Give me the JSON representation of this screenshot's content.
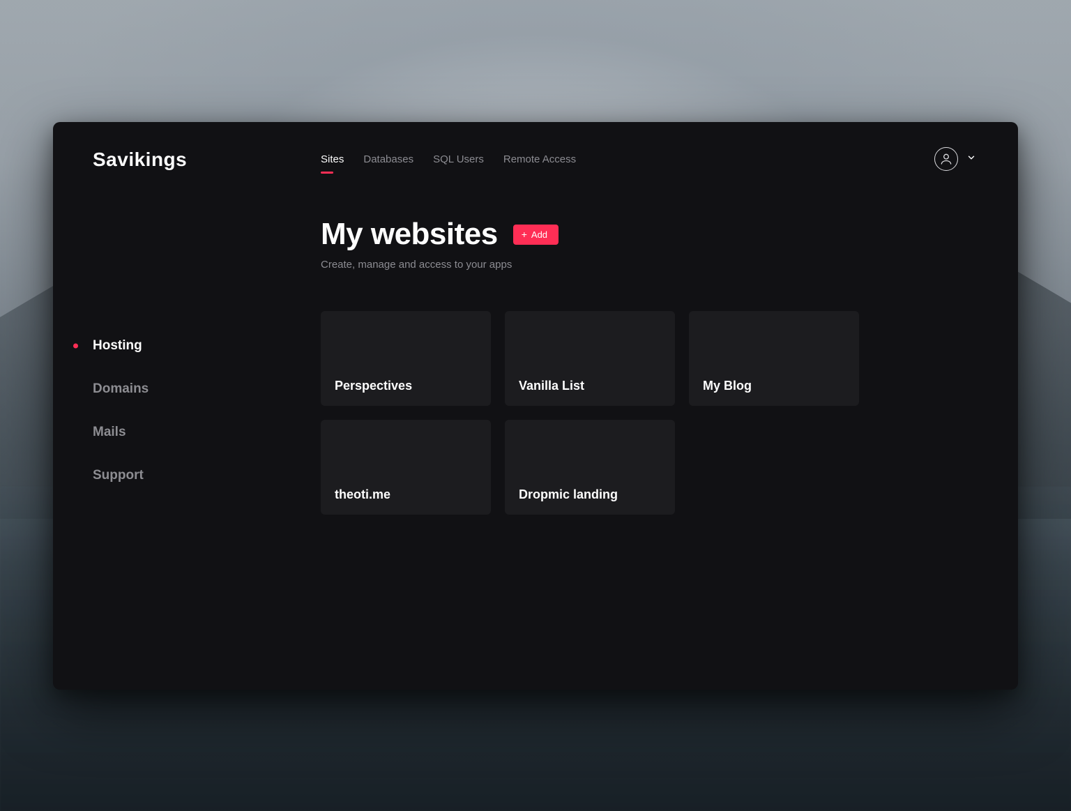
{
  "brand": "Savikings",
  "sidebar": {
    "items": [
      {
        "label": "Hosting",
        "active": true
      },
      {
        "label": "Domains",
        "active": false
      },
      {
        "label": "Mails",
        "active": false
      },
      {
        "label": "Support",
        "active": false
      }
    ]
  },
  "tabs": [
    {
      "label": "Sites",
      "active": true
    },
    {
      "label": "Databases",
      "active": false
    },
    {
      "label": "SQL Users",
      "active": false
    },
    {
      "label": "Remote Access",
      "active": false
    }
  ],
  "page": {
    "title": "My websites",
    "subtitle": "Create, manage and access to your apps",
    "add_label": "Add"
  },
  "sites": [
    {
      "title": "Perspectives"
    },
    {
      "title": "Vanilla List"
    },
    {
      "title": "My Blog"
    },
    {
      "title": "theoti.me"
    },
    {
      "title": "Dropmic landing"
    }
  ],
  "colors": {
    "accent": "#ff2e55",
    "panel": "#111114",
    "card": "#1c1c1f"
  }
}
